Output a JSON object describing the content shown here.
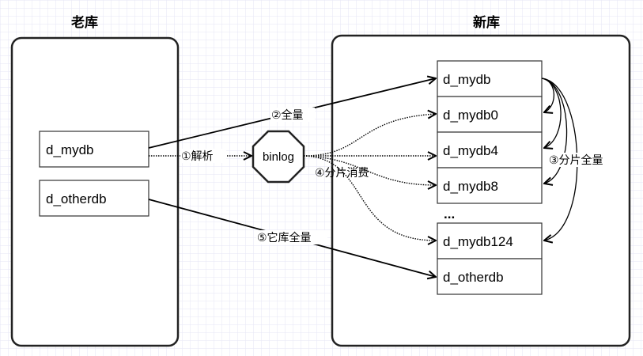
{
  "old_db": {
    "title": "老库",
    "items": [
      "d_mydb",
      "d_otherdb"
    ]
  },
  "new_db": {
    "title": "新库",
    "items": [
      "d_mydb",
      "d_mydb0",
      "d_mydb4",
      "d_mydb8",
      "d_mydb124",
      "d_otherdb"
    ],
    "ellipsis": "..."
  },
  "binlog": {
    "label": "binlog"
  },
  "edges": {
    "parse": "①解析",
    "full": "②全量",
    "shard_full": "③分片全量",
    "shard_consume": "④分片消费",
    "other_full": "⑤它库全量"
  }
}
